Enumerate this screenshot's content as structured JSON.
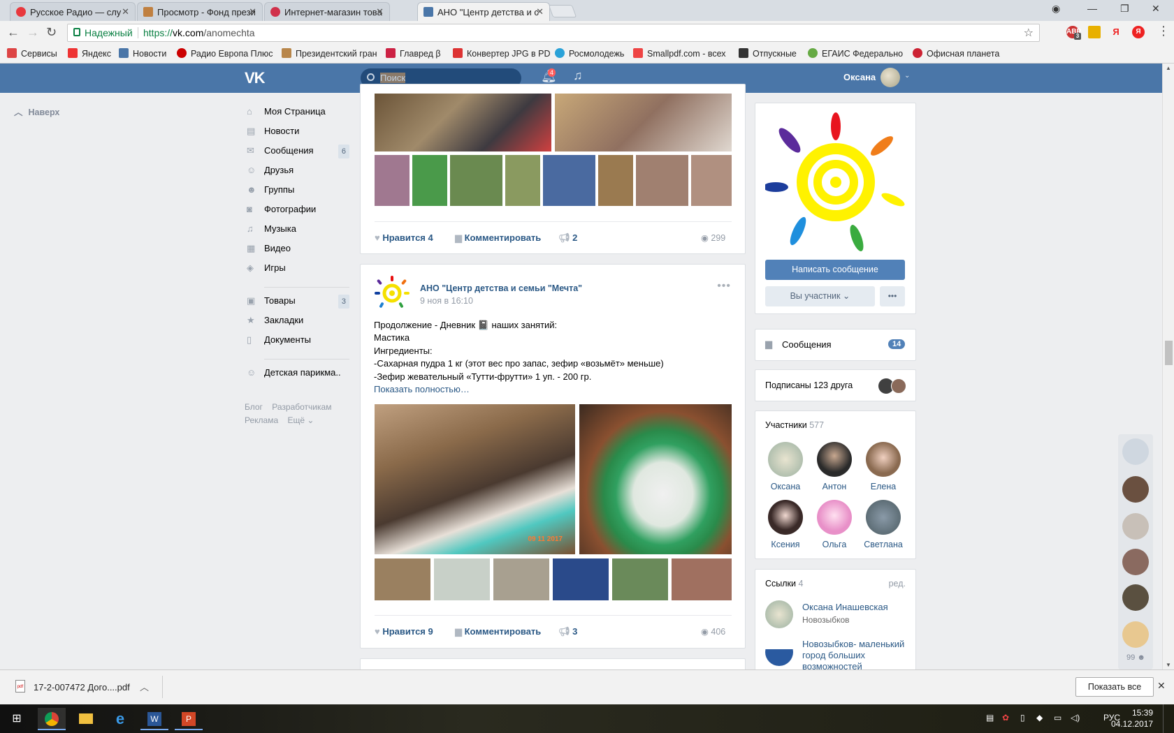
{
  "browser": {
    "tabs": [
      {
        "title": "Русское Радио — слу",
        "icon_color": "#e8383d"
      },
      {
        "title": "Просмотр - Фонд прези",
        "icon_color": "#c08040"
      },
      {
        "title": "Интернет-магазин това",
        "icon_color": "#d0304a"
      },
      {
        "title": "АНО \"Центр детства и с",
        "icon_color": "#4a76a8",
        "active": true
      }
    ],
    "secure_label": "Надежный",
    "url_prefix": "https://",
    "url_host": "vk.com",
    "url_path": "/anomechta",
    "bookmarks": [
      {
        "label": "Сервисы",
        "color": "#d44"
      },
      {
        "label": "Яндекс",
        "color": "#e33"
      },
      {
        "label": "Новости",
        "color": "#4a76a8"
      },
      {
        "label": "Радио Европа Плюс",
        "color": "#c00"
      },
      {
        "label": "Президентский гран",
        "color": "#b8864a"
      },
      {
        "label": "Главред β",
        "color": "#c24"
      },
      {
        "label": "Конвертер JPG в PD",
        "color": "#d33"
      },
      {
        "label": "Росмолодежь",
        "color": "#2aa2d8"
      },
      {
        "label": "Smallpdf.com - всех",
        "color": "#e44"
      },
      {
        "label": "Отпускные",
        "color": "#333"
      },
      {
        "label": "ЕГАИС Федерально",
        "color": "#6a4"
      },
      {
        "label": "Офисная планета",
        "color": "#c23"
      }
    ],
    "ext_badge": "3"
  },
  "vk": {
    "search_placeholder": "Поиск",
    "notif_count": "4",
    "user_name": "Оксана",
    "back_to_top": "Наверх"
  },
  "left_nav": [
    {
      "label": "Моя Страница",
      "icon": "home-icon",
      "glyph": "⌂"
    },
    {
      "label": "Новости",
      "icon": "news-icon",
      "glyph": "▤"
    },
    {
      "label": "Сообщения",
      "icon": "messages-icon",
      "glyph": "✉",
      "count": "6"
    },
    {
      "label": "Друзья",
      "icon": "friends-icon",
      "glyph": "☺"
    },
    {
      "label": "Группы",
      "icon": "groups-icon",
      "glyph": "☻"
    },
    {
      "label": "Фотографии",
      "icon": "camera-icon",
      "glyph": "◙"
    },
    {
      "label": "Музыка",
      "icon": "music-icon",
      "glyph": "♫"
    },
    {
      "label": "Видео",
      "icon": "video-icon",
      "glyph": "▦"
    },
    {
      "label": "Игры",
      "icon": "games-icon",
      "glyph": "◈"
    }
  ],
  "left_nav2": [
    {
      "label": "Товары",
      "icon": "bag-icon",
      "glyph": "▣",
      "count": "3"
    },
    {
      "label": "Закладки",
      "icon": "star-icon",
      "glyph": "★"
    },
    {
      "label": "Документы",
      "icon": "document-icon",
      "glyph": "▯"
    }
  ],
  "left_nav3": [
    {
      "label": "Детская парикма..",
      "icon": "community-icon",
      "glyph": "☺"
    }
  ],
  "left_footer": {
    "blog": "Блог",
    "dev": "Разработчикам",
    "ads": "Реклама",
    "more": "Ещё"
  },
  "post1": {
    "like_label": "Нравится",
    "likes": "4",
    "comment_label": "Комментировать",
    "shares": "2",
    "views": "299"
  },
  "post2": {
    "group_name": "АНО \"Центр детства и семьи \"Мечта\"",
    "date": "9 ноя в 16:10",
    "text_lines": [
      "Продолжение - Дневник 📓 наших занятий:",
      "Мастика",
      "Ингредиенты:",
      "-Сахарная пудра 1 кг (этот вес про запас, зефир «возьмёт» меньше)",
      "-Зефир жевательный «Тутти-фрутти» 1 уп. - 200 гр."
    ],
    "show_more": "Показать полностью…",
    "photo_date": "09 11 2017",
    "like_label": "Нравится",
    "likes": "9",
    "comment_label": "Комментировать",
    "shares": "3",
    "views": "406"
  },
  "sidebar": {
    "write_button": "Написать сообщение",
    "member_button": "Вы участник",
    "messages_label": "Сообщения",
    "messages_count": "14",
    "subscribed_label": "Подписаны 123 друга",
    "members_title": "Участники",
    "members_count": "577",
    "members": [
      {
        "name": "Оксана",
        "color": "#c9c4b0"
      },
      {
        "name": "Антон",
        "color": "#5a5a58"
      },
      {
        "name": "Елена",
        "color": "#b89a84"
      },
      {
        "name": "Ксения",
        "color": "#4a3b35"
      },
      {
        "name": "Ольга",
        "color": "#e8a0c8"
      },
      {
        "name": "Светлана",
        "color": "#6a7a8a"
      }
    ],
    "links_title": "Ссылки",
    "links_count": "4",
    "links_edit": "ред.",
    "links": [
      {
        "name": "Оксана Инашевская",
        "sub": "Новозыбков"
      },
      {
        "name": "Новозыбков- маленький город больших возможностей",
        "sub": ""
      }
    ]
  },
  "right_strip": {
    "count": "99"
  },
  "download": {
    "file": "17-2-007472 Дого....pdf",
    "file_badge": "pdf",
    "show_all": "Показать все"
  },
  "taskbar": {
    "lang": "РУС",
    "time": "15:39",
    "date": "04.12.2017"
  },
  "colors": {
    "vk_blue": "#4a76a8",
    "link": "#2a5885",
    "button_blue": "#5181b8"
  }
}
